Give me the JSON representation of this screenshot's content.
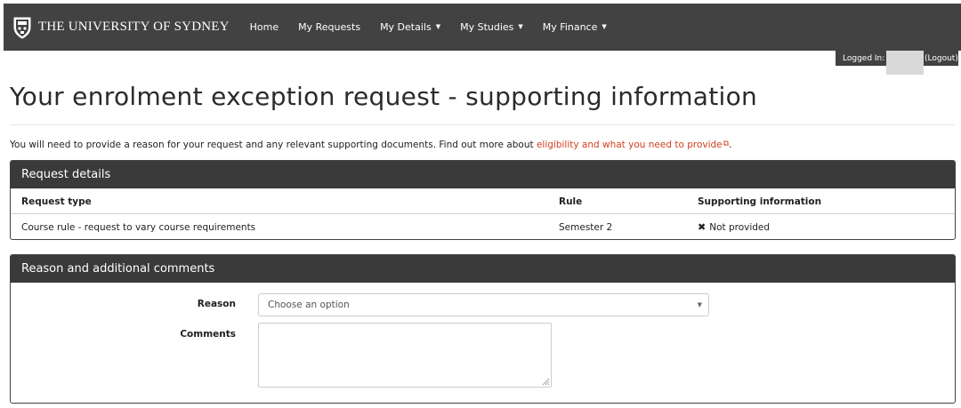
{
  "navbar": {
    "brand": "THE UNIVERSITY OF SYDNEY",
    "brand_icon": "university-crest-icon",
    "items": [
      {
        "label": "Home",
        "dropdown": false
      },
      {
        "label": "My Requests",
        "dropdown": false
      },
      {
        "label": "My Details",
        "dropdown": true
      },
      {
        "label": "My Studies",
        "dropdown": true
      },
      {
        "label": "My Finance",
        "dropdown": true
      }
    ]
  },
  "session": {
    "logged_in_label": "Logged In:",
    "logout_label": "(Logout)"
  },
  "page": {
    "title": "Your enrolment exception request - supporting information",
    "intro_text": "You will need to provide a reason for your request and any relevant supporting documents. Find out more about ",
    "intro_link": "eligibility and what you need to provide",
    "intro_end": "."
  },
  "request_details": {
    "heading": "Request details",
    "columns": [
      "Request type",
      "Rule",
      "Supporting information"
    ],
    "rows": [
      {
        "request_type": "Course rule - request to vary course requirements",
        "rule": "Semester 2",
        "supporting": "Not provided",
        "supporting_icon": "x-mark-icon"
      }
    ]
  },
  "reason_section": {
    "heading": "Reason and additional comments",
    "reason_label": "Reason",
    "reason_placeholder": "Choose an option",
    "comments_label": "Comments",
    "comments_value": ""
  },
  "colors": {
    "navbar_bg": "#424242",
    "link": "#d0401e",
    "panel_heading_bg": "#3a3a3a"
  }
}
